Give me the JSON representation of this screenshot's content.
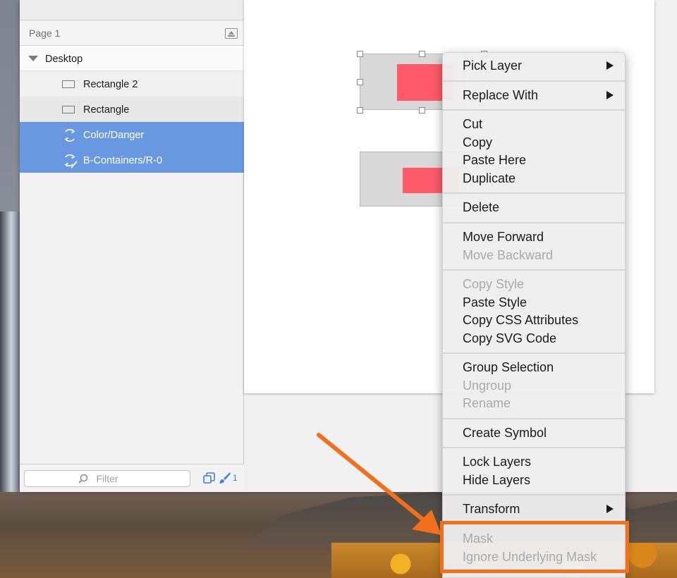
{
  "sidebar": {
    "page_label": "Page 1",
    "layers": [
      {
        "label": "Desktop"
      },
      {
        "label": "Rectangle 2"
      },
      {
        "label": "Rectangle"
      },
      {
        "label": "Color/Danger"
      },
      {
        "label": "B-Containers/R-0"
      }
    ],
    "filter_placeholder": "Filter",
    "footer_count": "1"
  },
  "context_menu": {
    "items": [
      {
        "label": "Pick Layer",
        "enabled": true,
        "submenu": true
      },
      {
        "label": "Replace With",
        "enabled": true,
        "submenu": true
      },
      {
        "label": "Cut",
        "enabled": true
      },
      {
        "label": "Copy",
        "enabled": true
      },
      {
        "label": "Paste Here",
        "enabled": true
      },
      {
        "label": "Duplicate",
        "enabled": true
      },
      {
        "label": "Delete",
        "enabled": true
      },
      {
        "label": "Move Forward",
        "enabled": true
      },
      {
        "label": "Move Backward",
        "enabled": false
      },
      {
        "label": "Copy Style",
        "enabled": false
      },
      {
        "label": "Paste Style",
        "enabled": true
      },
      {
        "label": "Copy CSS Attributes",
        "enabled": true
      },
      {
        "label": "Copy SVG Code",
        "enabled": true
      },
      {
        "label": "Group Selection",
        "enabled": true
      },
      {
        "label": "Ungroup",
        "enabled": false
      },
      {
        "label": "Rename",
        "enabled": false
      },
      {
        "label": "Create Symbol",
        "enabled": true
      },
      {
        "label": "Lock Layers",
        "enabled": true
      },
      {
        "label": "Hide Layers",
        "enabled": true
      },
      {
        "label": "Transform",
        "enabled": true,
        "submenu": true
      },
      {
        "label": "Mask",
        "enabled": false
      },
      {
        "label": "Ignore Underlying Mask",
        "enabled": false
      }
    ]
  },
  "colors": {
    "selection": "#6899e0",
    "danger_fill": "#ff5a6a",
    "annotation": "#f26f1b",
    "accent": "#3d7de0"
  },
  "icons": {
    "rectangle_layer": "rectangle-icon",
    "symbol_layer": "symbol-icon",
    "symbol_override": "symbol-override-icon",
    "filter": "search-icon",
    "collapse": "collapse-icon",
    "copy_footer": "copy-icon",
    "brush_footer": "brush-icon"
  }
}
